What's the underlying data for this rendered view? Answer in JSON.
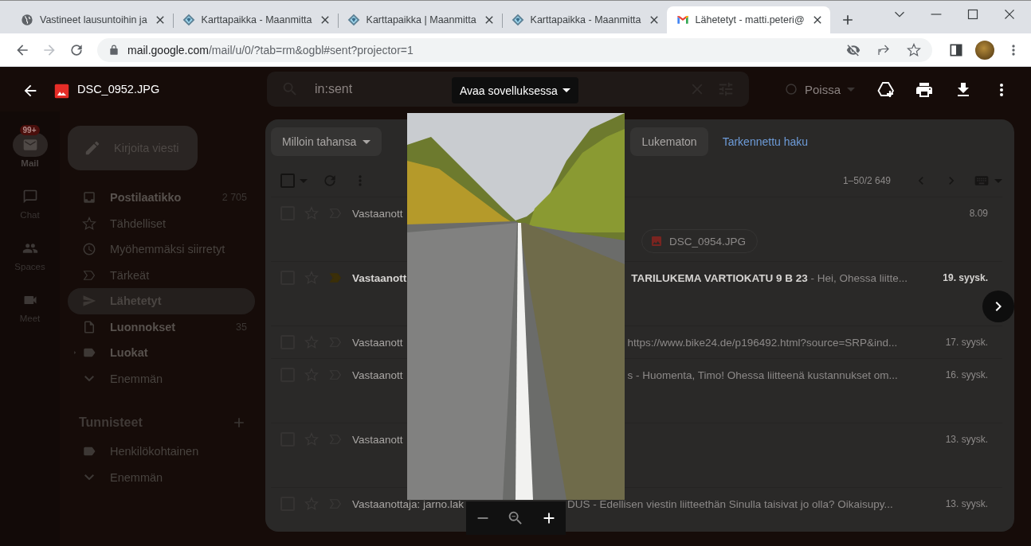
{
  "browser": {
    "tabs": [
      {
        "title": "Vastineet lausuntoihin ja",
        "kind": "globe",
        "selected": false
      },
      {
        "title": "Karttapaikka - Maanmitta",
        "kind": "map",
        "selected": false
      },
      {
        "title": "Karttapaikka | Maanmitta",
        "kind": "map",
        "selected": false
      },
      {
        "title": "Karttapaikka - Maanmitta",
        "kind": "map",
        "selected": false
      },
      {
        "title": "Lähetetyt - matti.peteri@",
        "kind": "mail",
        "selected": true
      }
    ],
    "url_host": "mail.google.com",
    "url_path": "/mail/u/0/?tab=rm&ogbl#sent?projector=1"
  },
  "viewer": {
    "filename": "DSC_0952.JPG",
    "open_with": "Avaa sovelluksessa"
  },
  "gmail": {
    "search": {
      "value": "in:sent"
    },
    "status": "Poissa",
    "rail": [
      {
        "label": "Mail",
        "kind": "mail",
        "badge": "99+",
        "selected": true
      },
      {
        "label": "Chat",
        "kind": "chat",
        "selected": false
      },
      {
        "label": "Spaces",
        "kind": "spaces",
        "selected": false
      },
      {
        "label": "Meet",
        "kind": "meet",
        "selected": false
      }
    ],
    "compose": "Kirjoita viesti",
    "nav": [
      {
        "label": "Postilaatikko",
        "count": "2 705",
        "kind": "inbox",
        "unread": true,
        "selected": false
      },
      {
        "label": "Tähdelliset",
        "kind": "star",
        "unread": false,
        "selected": false
      },
      {
        "label": "Myöhemmäksi siirretyt",
        "kind": "clock",
        "unread": false,
        "selected": false
      },
      {
        "label": "Tärkeät",
        "kind": "important",
        "unread": false,
        "selected": false
      },
      {
        "label": "Lähetetyt",
        "kind": "sent",
        "unread": false,
        "selected": true
      },
      {
        "label": "Luonnokset",
        "count": "35",
        "kind": "draft",
        "unread": true,
        "selected": false
      },
      {
        "label": "Luokat",
        "kind": "category",
        "unread": true,
        "selected": false
      },
      {
        "label": "Enemmän",
        "kind": "more",
        "unread": false,
        "selected": false
      }
    ],
    "labels_title": "Tunnisteet",
    "labels": [
      {
        "label": "Henkilökohtainen",
        "kind": "label",
        "unread": false,
        "selected": false
      },
      {
        "label": "Enemmän",
        "kind": "more",
        "unread": false,
        "selected": false
      }
    ],
    "filters": [
      {
        "label": "Milloin tahansa",
        "kind": "dropdown"
      },
      {
        "label": "Lukematon",
        "kind": "chip"
      },
      {
        "label": "Tarkennettu haku",
        "kind": "link"
      }
    ],
    "select_all": {
      "checked": false
    },
    "pager": "1–50/2 649",
    "rows": [
      {
        "sender": "Vastaanott",
        "preview": "",
        "date": "8.09",
        "attachment": "DSC_0954.JPG",
        "kind": "with-attachment",
        "unread": false,
        "important": false,
        "starred": false,
        "checked": false
      },
      {
        "sender": "Vastaanott",
        "preview": "**TARILUKEMA VARTIOKATU 9 B 23** - Hei, Ohessa liitte...",
        "date": "19. syysk.",
        "kind": "with-attachment",
        "unread": true,
        "important": true,
        "starred": false,
        "checked": false
      },
      {
        "sender": "Vastaanott",
        "preview": "https://www.bike24.de/p196492.html?source=SRP&ind...",
        "date": "17. syysk.",
        "kind": "plain",
        "unread": false,
        "important": false,
        "starred": false,
        "checked": false
      },
      {
        "sender": "Vastaanott",
        "preview": "s - Huomenta, Timo! Ohessa liitteenä kustannukset om...",
        "date": "16. syysk.",
        "kind": "with-attachment",
        "unread": false,
        "important": false,
        "starred": false,
        "checked": false
      },
      {
        "sender": "Vastaanott",
        "preview": "",
        "date": "13. syysk.",
        "kind": "with-attachment",
        "unread": false,
        "important": false,
        "starred": false,
        "checked": false
      },
      {
        "sender": "Vastaanottaja: jarno.lak",
        "preview": "DUS - Edellisen viestin liitteethän Sinulla taisivat jo olla? Oikaisupy...",
        "date": "13. syysk.",
        "kind": "below-photo",
        "unread": false,
        "important": false,
        "starred": false,
        "checked": false
      }
    ]
  }
}
